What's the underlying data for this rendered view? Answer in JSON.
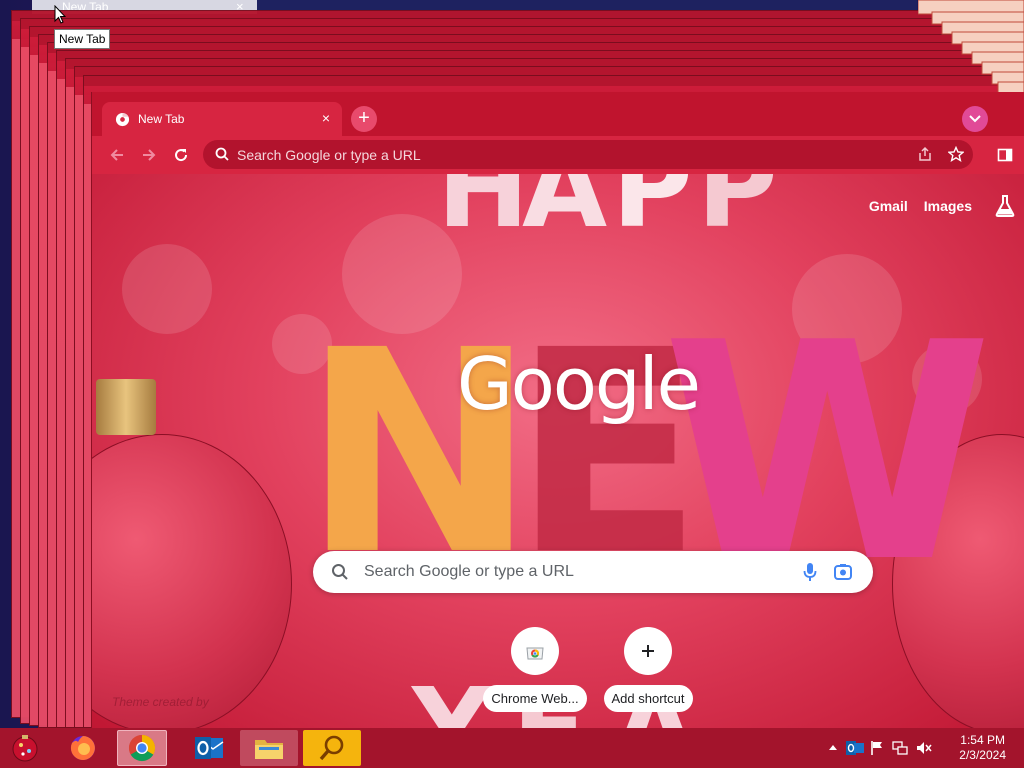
{
  "tooltip": "New Tab",
  "ghost_tab": {
    "title": "New Tab",
    "close": "×"
  },
  "window": {
    "tab_title": "New Tab",
    "tab_close": "×",
    "new_tab": "+",
    "omnibox_placeholder": "Search Google or type a URL"
  },
  "ntp": {
    "links": {
      "gmail": "Gmail",
      "images": "Images"
    },
    "logo": "Google",
    "search_placeholder": "Search Google or type a URL",
    "shortcuts": [
      {
        "label": "Chrome Web...",
        "icon": "chrome-web-store-icon"
      },
      {
        "label": "Add shortcut",
        "icon": "plus-icon"
      }
    ],
    "theme_credit": "Theme created by"
  },
  "taskbar": {
    "apps": [
      "start-ornament-icon",
      "firefox-icon",
      "chrome-icon",
      "outlook-icon",
      "file-explorer-icon",
      "search-magnifier-icon"
    ],
    "clock": {
      "time": "1:54 PM",
      "date": "2/3/2024"
    }
  },
  "colors": {
    "accent": "#d8203c",
    "tabstrip": "#c0142e",
    "omnibox": "#b2132d",
    "taskbar": "#a3142c"
  }
}
